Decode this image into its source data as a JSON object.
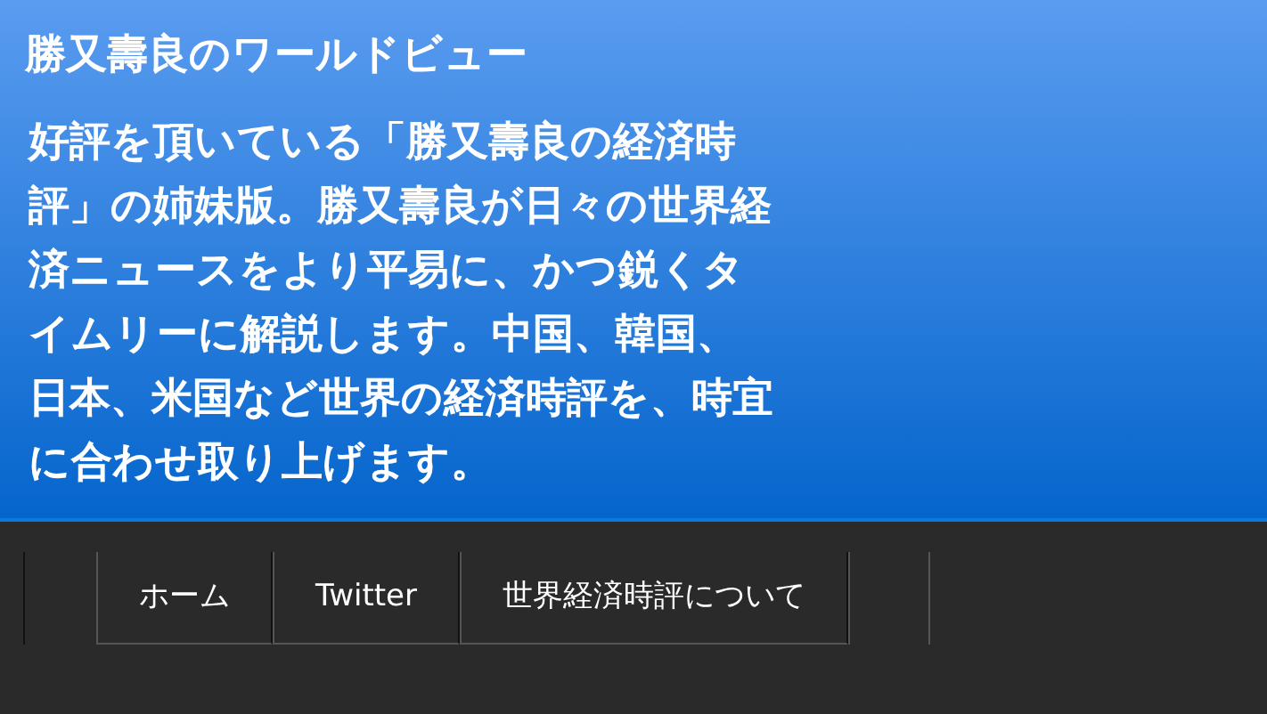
{
  "site": {
    "title": "勝又壽良のワールドビュー",
    "description": "好評を頂いている「勝又壽良の経済時評」の姉妹版。勝又壽良が日々の世界経済ニュースをより平易に、かつ鋭くタイムリーに解説します。中国、韓国、日本、米国など世界の経済時評を、時宜に合わせ取り上げます。"
  },
  "nav": [
    {
      "label": "ホーム"
    },
    {
      "label": "Twitter"
    },
    {
      "label": "世界経済時評について"
    }
  ]
}
